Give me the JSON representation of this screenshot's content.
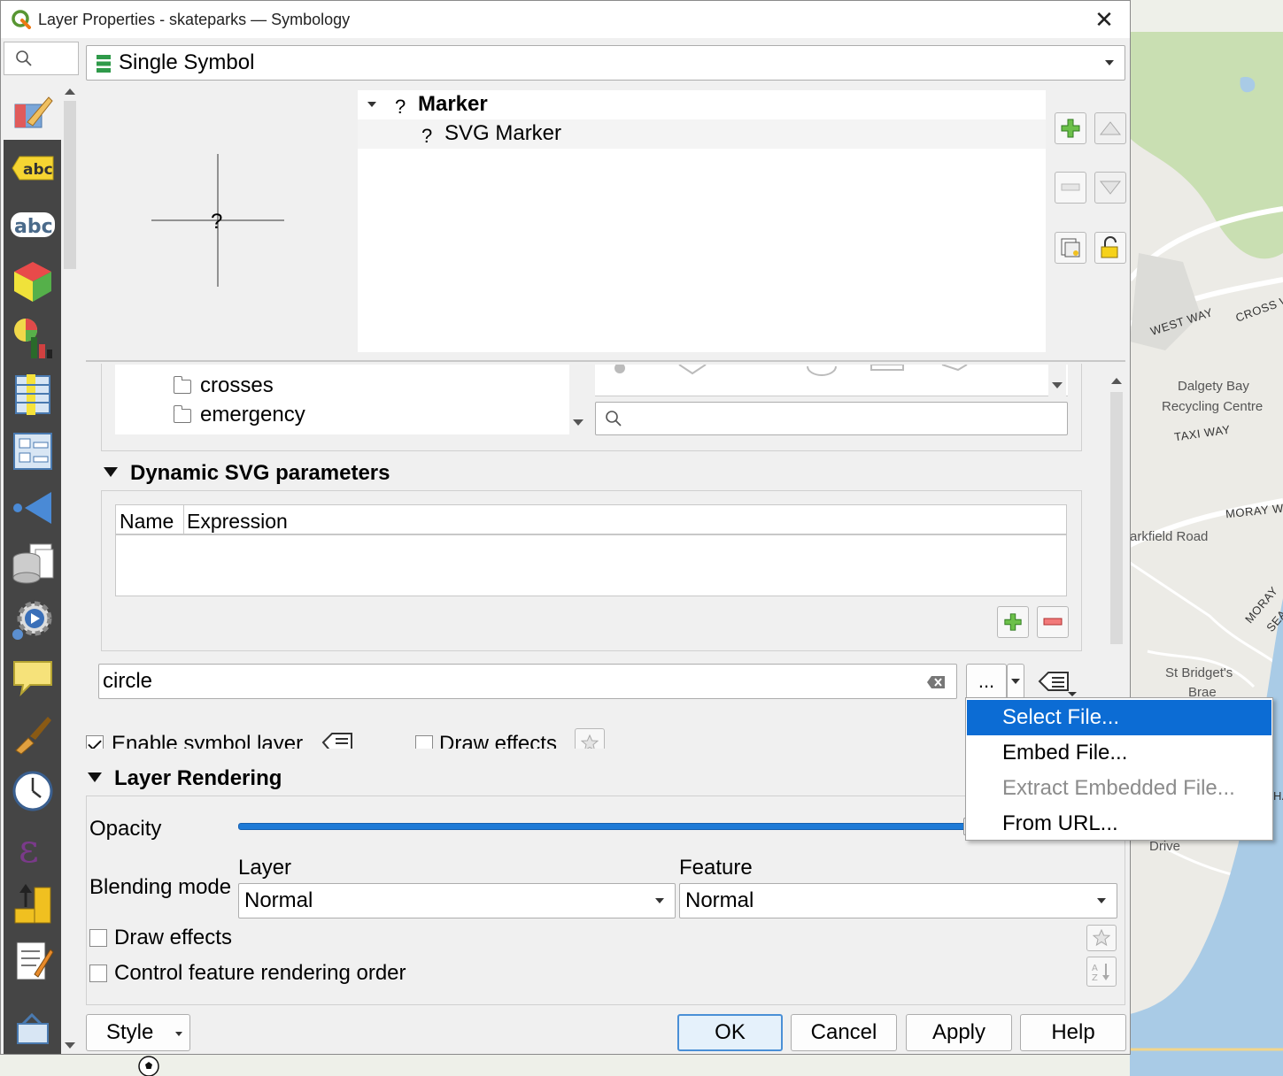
{
  "window": {
    "title": "Layer Properties - skateparks — Symbology",
    "close_symbol": "✕"
  },
  "renderer": {
    "selected": "Single Symbol"
  },
  "symbol_tree": {
    "root_label": "Marker",
    "child_label": "SVG Marker",
    "unknown_glyph": "?"
  },
  "svg_browser": {
    "folders": [
      "crosses",
      "emergency"
    ]
  },
  "dynamic_svg": {
    "header": "Dynamic SVG parameters",
    "columns": [
      "Name",
      "Expression"
    ]
  },
  "svg_source": {
    "value": "circle",
    "ellipsis_label": "..."
  },
  "symbol_layer": {
    "enable_label": "Enable symbol layer",
    "enable_checked": true,
    "draw_effects_label": "Draw effects"
  },
  "layer_rendering": {
    "header": "Layer Rendering",
    "opacity_label": "Opacity",
    "opacity_value": 1.0,
    "blending_label": "Blending mode",
    "layer_label": "Layer",
    "feature_label": "Feature",
    "layer_mode": "Normal",
    "feature_mode": "Normal",
    "draw_effects_label": "Draw effects",
    "control_order_label": "Control feature rendering order"
  },
  "buttons": {
    "style": "Style",
    "ok": "OK",
    "cancel": "Cancel",
    "apply": "Apply",
    "help": "Help"
  },
  "context_menu": {
    "items": [
      {
        "label": "Select File...",
        "state": "highlighted"
      },
      {
        "label": "Embed File...",
        "state": "normal"
      },
      {
        "label": "Extract Embedded File...",
        "state": "disabled"
      },
      {
        "label": "From URL...",
        "state": "normal"
      }
    ]
  },
  "map_labels": {
    "west_way": "WEST WAY",
    "cross": "CROSS W",
    "dalgety": "Dalgety Bay",
    "recycling": "Recycling Centre",
    "taxi_way": "TAXI WAY",
    "moray_w": "MORAY W",
    "markfield": "arkfield Road",
    "moray2": "MORAY",
    "sea": "SEA",
    "st_bridgets": "St Bridget's",
    "brae": "Brae",
    "drive": "Drive",
    "ha": "HA"
  },
  "colors": {
    "menu_highlight": "#0c6cd4",
    "sidebar_bg": "#454545",
    "ok_border": "#4a8fd6",
    "slider": "#1e7ad6",
    "water": "#a9cbe6",
    "park": "#c9dfb2"
  }
}
